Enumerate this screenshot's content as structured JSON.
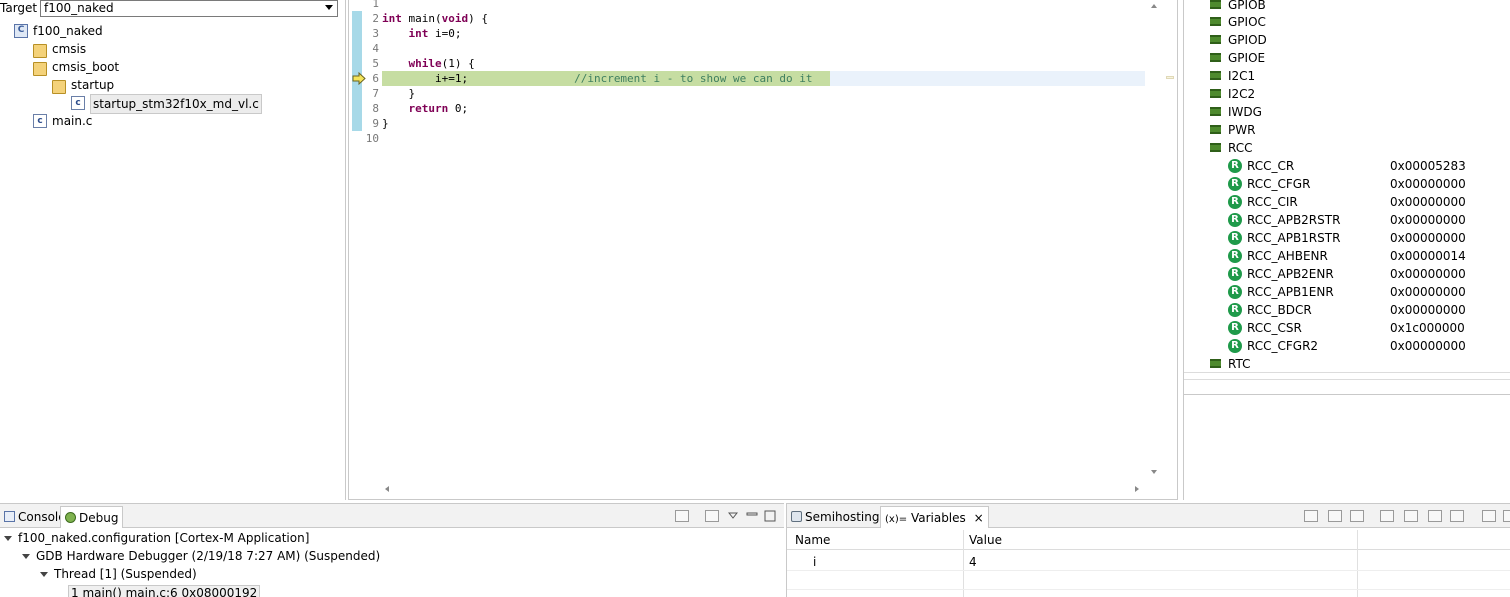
{
  "project_panel": {
    "target_label": "Target",
    "target_value": "f100_naked",
    "tree": [
      {
        "label": "f100_naked",
        "icon": "project-icon"
      },
      {
        "label": "cmsis",
        "icon": "folder-icon"
      },
      {
        "label": "cmsis_boot",
        "icon": "folder-icon"
      },
      {
        "label": "startup",
        "icon": "folder-icon"
      },
      {
        "label": "startup_stm32f10x_md_vl.c",
        "icon": "c-file-icon"
      },
      {
        "label": "main.c",
        "icon": "c-file-icon"
      }
    ]
  },
  "editor": {
    "lines": [
      {
        "num": "1"
      },
      {
        "num": "2"
      },
      {
        "num": "3"
      },
      {
        "num": "4"
      },
      {
        "num": "5"
      },
      {
        "num": "6"
      },
      {
        "num": "7"
      },
      {
        "num": "8"
      },
      {
        "num": "9"
      },
      {
        "num": "10"
      }
    ],
    "code": {
      "l2_kw": "int",
      "l2_rest": " main(",
      "l2_kw2": "void",
      "l2_end": ") {",
      "l3_kw": "int",
      "l3_rest": " i=0;",
      "l5_kw": "while",
      "l5_rest": "(1) {",
      "l6_code": "i+=1;",
      "l6_comment": "//increment i - to show we can do it",
      "l7": "}",
      "l8_kw": "return",
      "l8_rest": " 0;",
      "l9": "}"
    }
  },
  "registers": {
    "peripherals_top": [
      "GPIOB",
      "GPIOC",
      "GPIOD",
      "GPIOE",
      "I2C1",
      "I2C2",
      "IWDG",
      "PWR",
      "RCC"
    ],
    "rcc_registers": [
      {
        "name": "RCC_CR",
        "value": "0x00005283"
      },
      {
        "name": "RCC_CFGR",
        "value": "0x00000000"
      },
      {
        "name": "RCC_CIR",
        "value": "0x00000000"
      },
      {
        "name": "RCC_APB2RSTR",
        "value": "0x00000000"
      },
      {
        "name": "RCC_APB1RSTR",
        "value": "0x00000000"
      },
      {
        "name": "RCC_AHBENR",
        "value": "0x00000014"
      },
      {
        "name": "RCC_APB2ENR",
        "value": "0x00000000"
      },
      {
        "name": "RCC_APB1ENR",
        "value": "0x00000000"
      },
      {
        "name": "RCC_BDCR",
        "value": "0x00000000"
      },
      {
        "name": "RCC_CSR",
        "value": "0x1c000000"
      },
      {
        "name": "RCC_CFGR2",
        "value": "0x00000000"
      }
    ],
    "peripherals_bottom": [
      "RTC"
    ]
  },
  "debug_panel": {
    "tabs": [
      "Console",
      "Debug"
    ],
    "rows": [
      "f100_naked.configuration [Cortex-M Application]",
      "GDB Hardware Debugger (2/19/18 7:27 AM) (Suspended)",
      "Thread [1] (Suspended)",
      "1 main() main.c:6 0x08000192"
    ]
  },
  "variables_panel": {
    "tabs": [
      "Semihosting",
      "Variables"
    ],
    "columns": [
      "Name",
      "Value"
    ],
    "rows": [
      {
        "name": "i",
        "value": "4"
      }
    ]
  },
  "colors": {
    "exec_line_highlight": "#c6dda2",
    "keyword": "#7f0055",
    "comment": "#3f7f5f",
    "register_icon": "#1f9a4a"
  }
}
